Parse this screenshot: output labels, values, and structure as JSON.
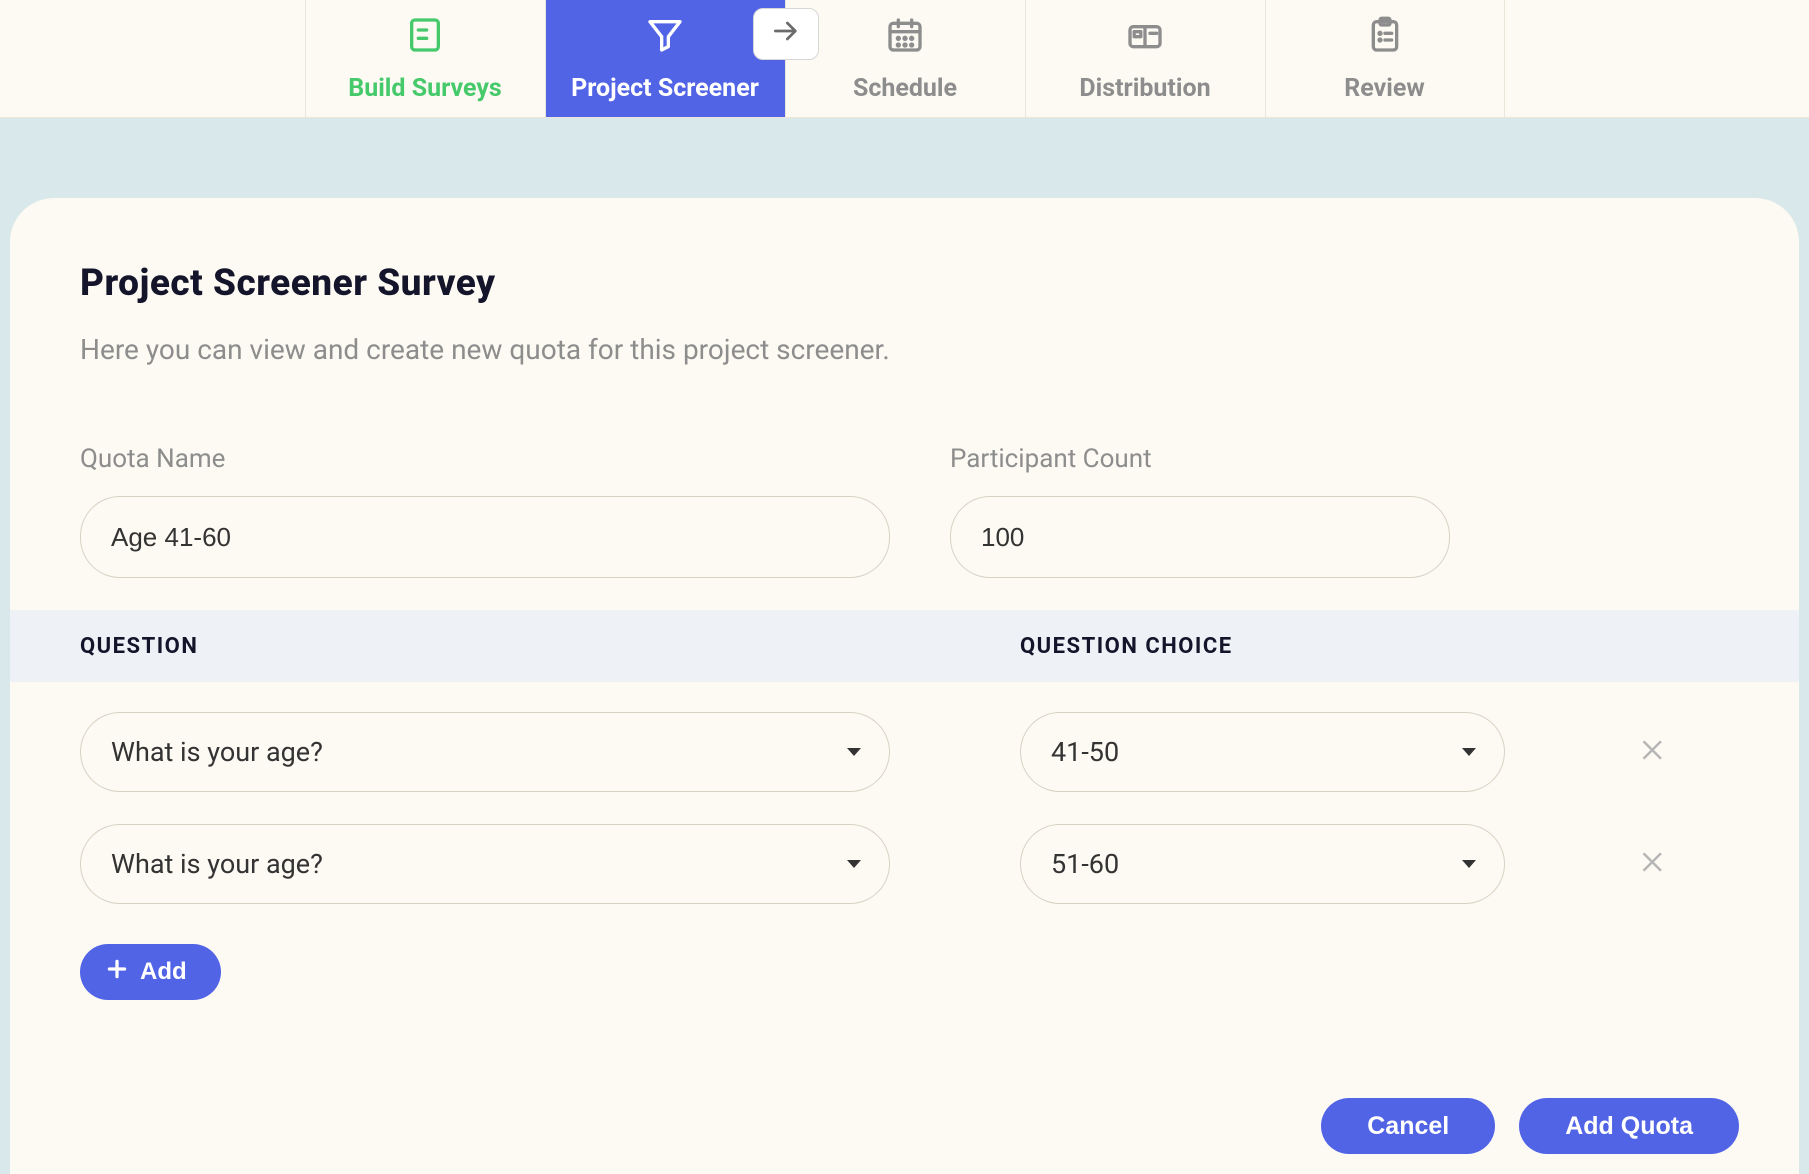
{
  "tabs": {
    "build": {
      "label": "Build Surveys"
    },
    "screener": {
      "label": "Project Screener"
    },
    "schedule": {
      "label": "Schedule"
    },
    "distribution": {
      "label": "Distribution"
    },
    "review": {
      "label": "Review"
    }
  },
  "page": {
    "title": "Project Screener Survey",
    "subtitle": "Here you can view and create new quota for this project screener."
  },
  "form": {
    "quota_name": {
      "label": "Quota Name",
      "value": "Age 41-60"
    },
    "participant": {
      "label": "Participant Count",
      "value": "100"
    }
  },
  "table": {
    "head_question": "QUESTION",
    "head_choice": "QUESTION CHOICE",
    "rows": [
      {
        "question": "What is your age?",
        "choice": "41-50"
      },
      {
        "question": "What is your age?",
        "choice": "51-60"
      }
    ]
  },
  "buttons": {
    "add": "Add",
    "cancel": "Cancel",
    "add_quota": "Add Quota"
  }
}
